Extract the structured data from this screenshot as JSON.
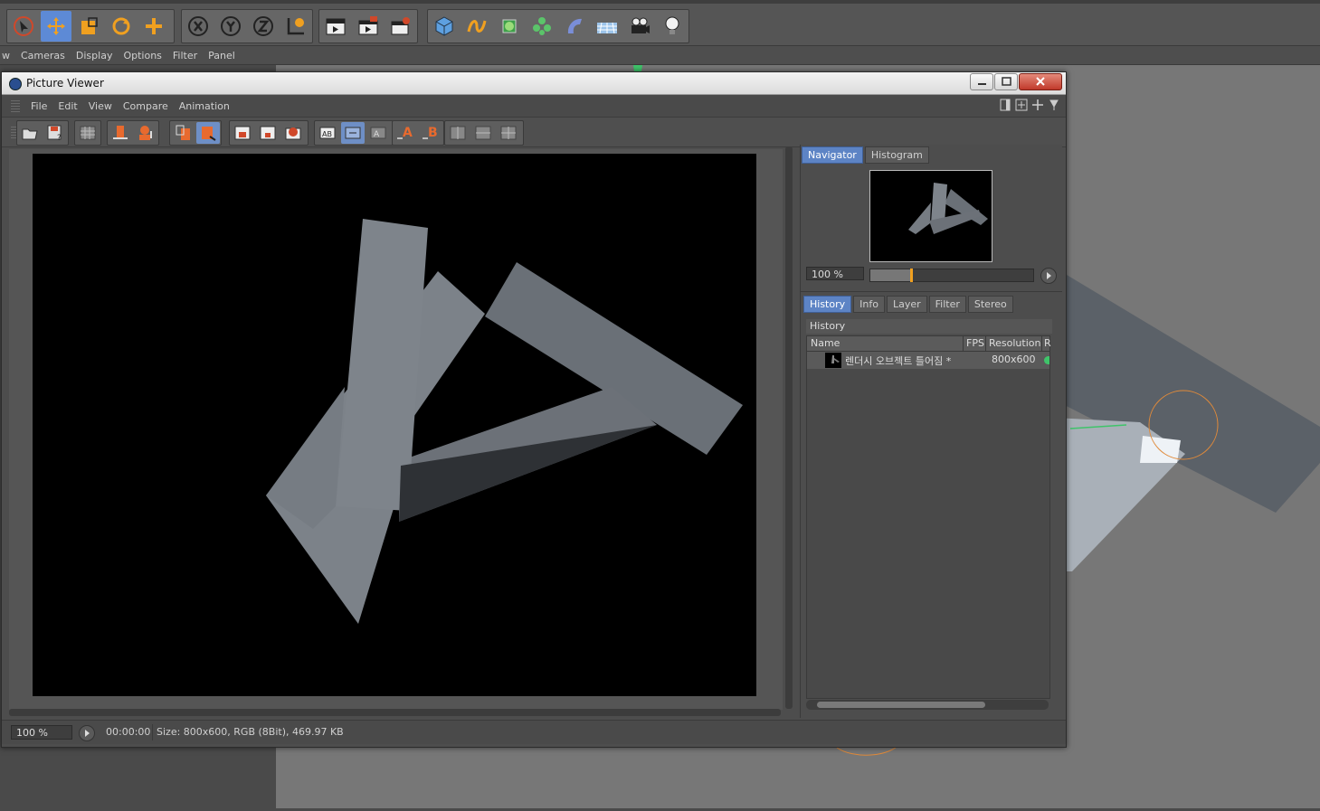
{
  "app": {
    "viewport_menu": [
      "w",
      "Cameras",
      "Display",
      "Options",
      "Filter",
      "Panel"
    ]
  },
  "picture_viewer": {
    "title": "Picture Viewer",
    "menu": [
      "File",
      "Edit",
      "View",
      "Compare",
      "Animation"
    ],
    "side_panel": {
      "top_tabs": [
        {
          "label": "Navigator",
          "active": true
        },
        {
          "label": "Histogram",
          "active": false
        }
      ],
      "zoom_value": "100 %",
      "zoom_fraction": 0.25,
      "bottom_tabs": [
        {
          "label": "History",
          "active": true
        },
        {
          "label": "Info",
          "active": false
        },
        {
          "label": "Layer",
          "active": false
        },
        {
          "label": "Filter",
          "active": false
        },
        {
          "label": "Stereo",
          "active": false
        }
      ],
      "history_title": "History",
      "columns": {
        "name": "Name",
        "fps": "FPS",
        "resolution": "Resolution",
        "r": "R"
      },
      "rows": [
        {
          "name": "렌더시 오브젝트 틀어짐 *",
          "resolution": "800x600",
          "status_color": "#3fc46a"
        }
      ]
    },
    "status": {
      "zoom": "100 %",
      "time": "00:00:00",
      "size": "Size: 800x600, RGB (8Bit), 469.97 KB"
    }
  },
  "colors": {
    "accent_blue": "#5d84c5",
    "icon_orange": "#f0a020",
    "shape_gray": "#6c7178"
  }
}
